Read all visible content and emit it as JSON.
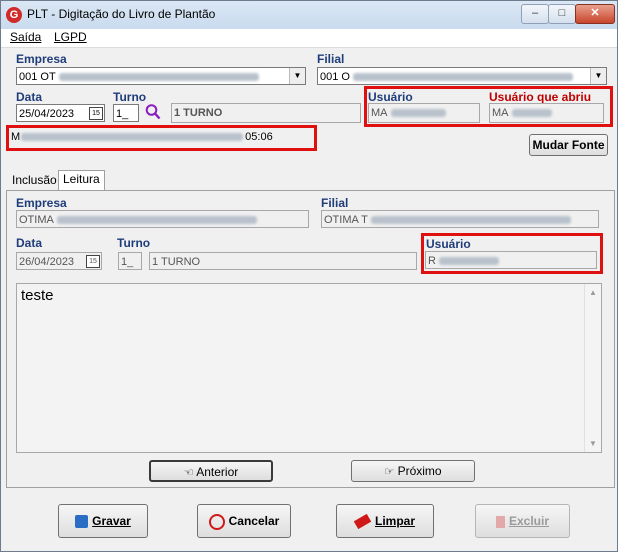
{
  "window": {
    "title": "PLT - Digitação do Livro de Plantão",
    "app_letter": "G",
    "min": "–",
    "max": "□",
    "close": "✕"
  },
  "menu": {
    "saida": "Saída",
    "lgpd": "LGPD"
  },
  "top": {
    "empresa_label": "Empresa",
    "empresa_value": "001 OT",
    "filial_label": "Filial",
    "filial_value": "001 O",
    "data_label": "Data",
    "data_value": "25/04/2023",
    "cal": "15",
    "turno_label": "Turno",
    "turno_code": "1_",
    "turno_desc": "1 TURNO",
    "usuario_label": "Usuário",
    "usuario_value": "MA",
    "usuario_abriu_label": "Usuário que abriu",
    "usuario_abriu_value": "MA",
    "status_prefix": "M",
    "status_suffix": "05:06",
    "mudar_fonte": "Mudar Fonte"
  },
  "tabs": {
    "inclusao": "Inclusão",
    "leitura": "Leitura"
  },
  "leitura": {
    "empresa_label": "Empresa",
    "empresa_value": "OTIMA",
    "filial_label": "Filial",
    "filial_value": "OTIMA T",
    "data_label": "Data",
    "data_value": "26/04/2023",
    "cal": "15",
    "turno_label": "Turno",
    "turno_code": "1_",
    "turno_desc": "1 TURNO",
    "usuario_label": "Usuário",
    "usuario_value": "R",
    "memo_text": "teste",
    "anterior": "Anterior",
    "proximo": "Próximo"
  },
  "footer": {
    "gravar": "Gravar",
    "cancelar": "Cancelar",
    "limpar": "Limpar",
    "excluir": "Excluir"
  },
  "colors": {
    "highlight": "#e01010",
    "label_blue": "#1f3d7a"
  }
}
